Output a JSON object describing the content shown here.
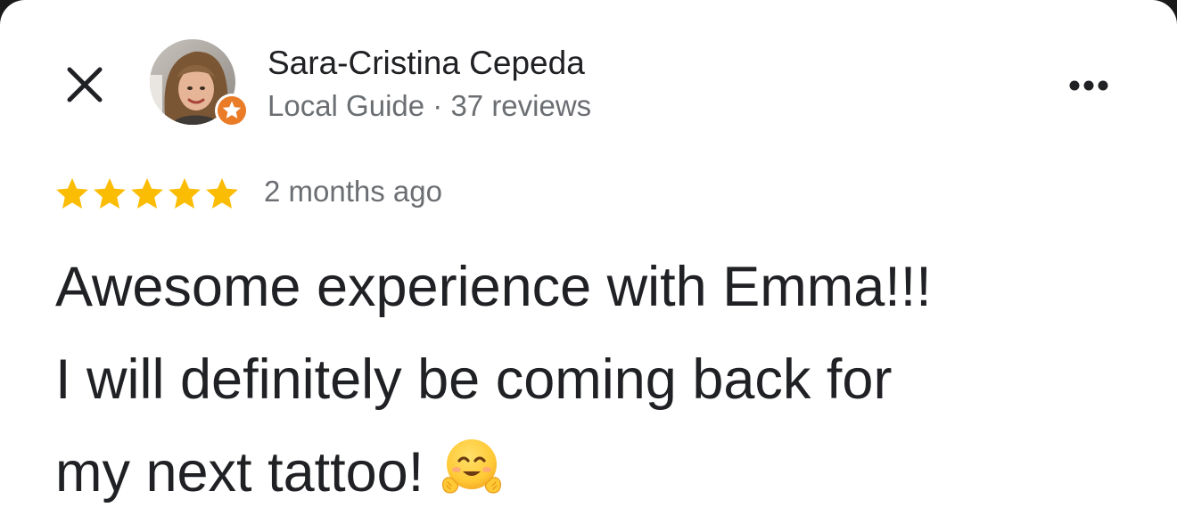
{
  "reviewer": {
    "name": "Sara-Cristina Cepeda",
    "meta": "Local Guide · 37 reviews",
    "avatar_icon": "profile-photo",
    "badge_icon": "local-guide-star-badge",
    "badge_color": "#ea7b27"
  },
  "header": {
    "close_icon": "close-icon",
    "more_icon": "more-options-icon"
  },
  "review": {
    "rating": 5,
    "rating_max": 5,
    "star_color": "#fbbc04",
    "time_ago": "2 months ago",
    "lines": [
      "Awesome experience with Emma!!!",
      "I will definitely be coming back for",
      "my next tattoo!"
    ],
    "emoji_icon": "hugging-face-emoji"
  }
}
